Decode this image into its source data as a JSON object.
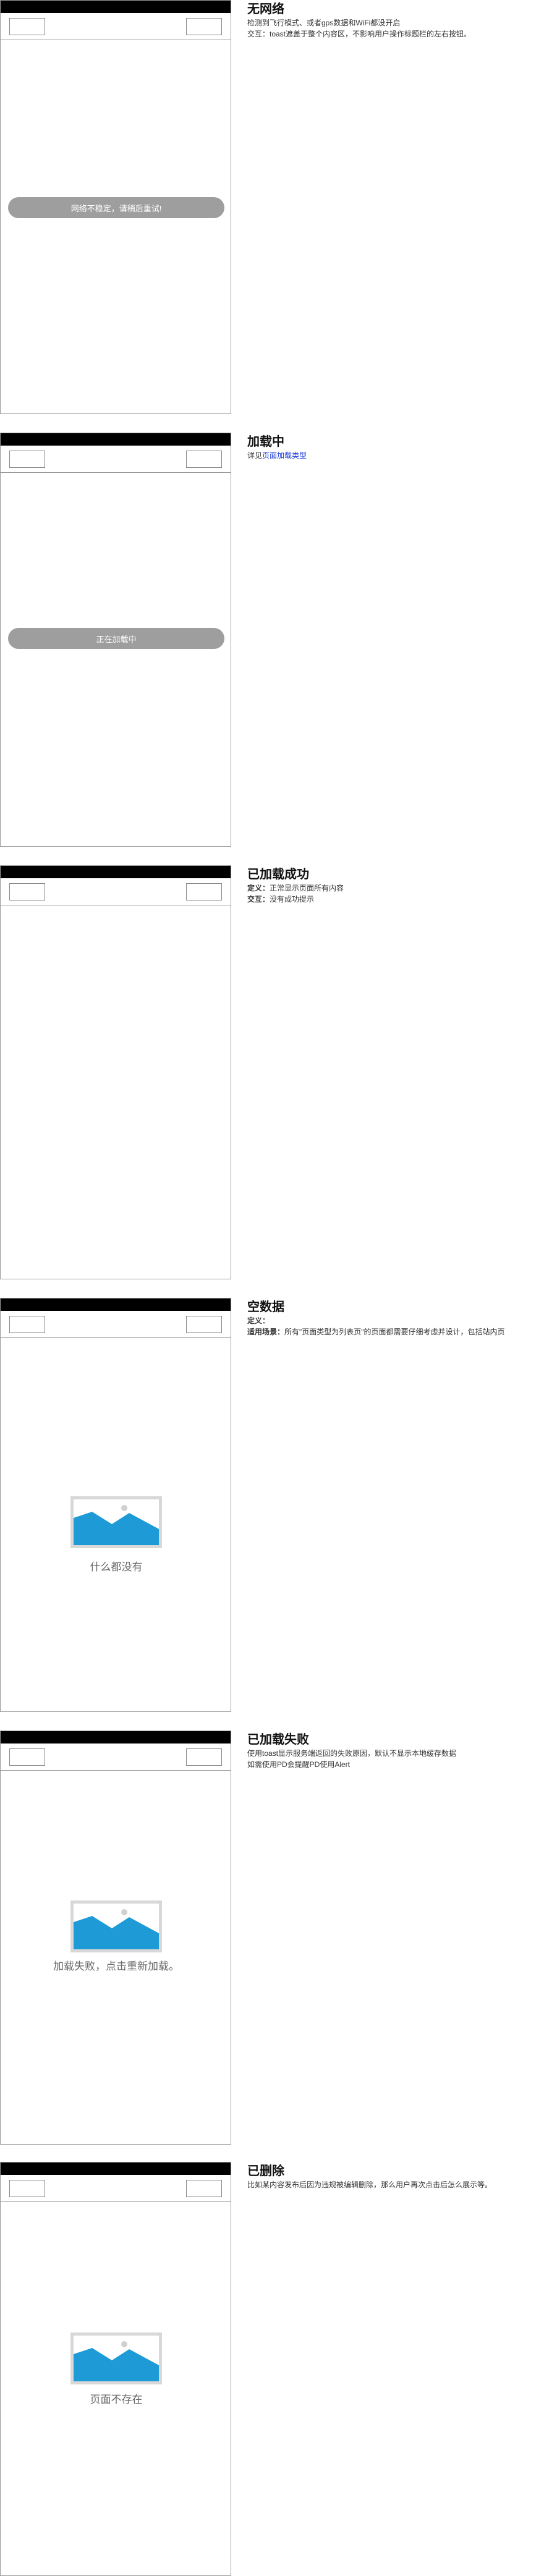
{
  "sections": [
    {
      "title": "无网络",
      "lines": [
        "检测到飞行模式、或者gps数据和WiFi都没开启",
        "交互：toast遮盖于整个内容区，不影响用户操作标题栏的左右按钮。"
      ],
      "toast": "网络不稳定，请稍后重试!"
    },
    {
      "title": "加载中",
      "link_prefix": "详见",
      "link_text": "页面加载类型",
      "toast": "正在加载中"
    },
    {
      "title": "已加载成功",
      "lines": [
        {
          "label": "定义：",
          "text": "正常显示页面所有内容"
        },
        {
          "label": "交互：",
          "text": "没有成功提示"
        }
      ]
    },
    {
      "title": "空数据",
      "lines": [
        {
          "label": "定义：",
          "text": ""
        },
        {
          "label": "适用场景：",
          "text": "所有\"页面类型为列表页\"的页面都需要仔细考虑并设计，包括站内页"
        }
      ],
      "caption": "什么都没有"
    },
    {
      "title": "已加载失败",
      "lines": [
        "使用toast显示服务端返回的失败原因，默认不显示本地缓存数据",
        "如需使用PD会提醒PD使用Alert"
      ],
      "caption": "加载失败，点击重新加载。"
    },
    {
      "title": "已删除",
      "lines": [
        "比如某内容发布后因为违规被编辑删除，那么用户再次点击后怎么展示等。"
      ],
      "caption": "页面不存在"
    }
  ],
  "colors": {
    "status_bar": "#000000",
    "toast_bg": "#9e9e9e",
    "image_frame": "#d8d8d8",
    "image_mountain": "#1e9ad6",
    "link": "#1a35d6"
  }
}
